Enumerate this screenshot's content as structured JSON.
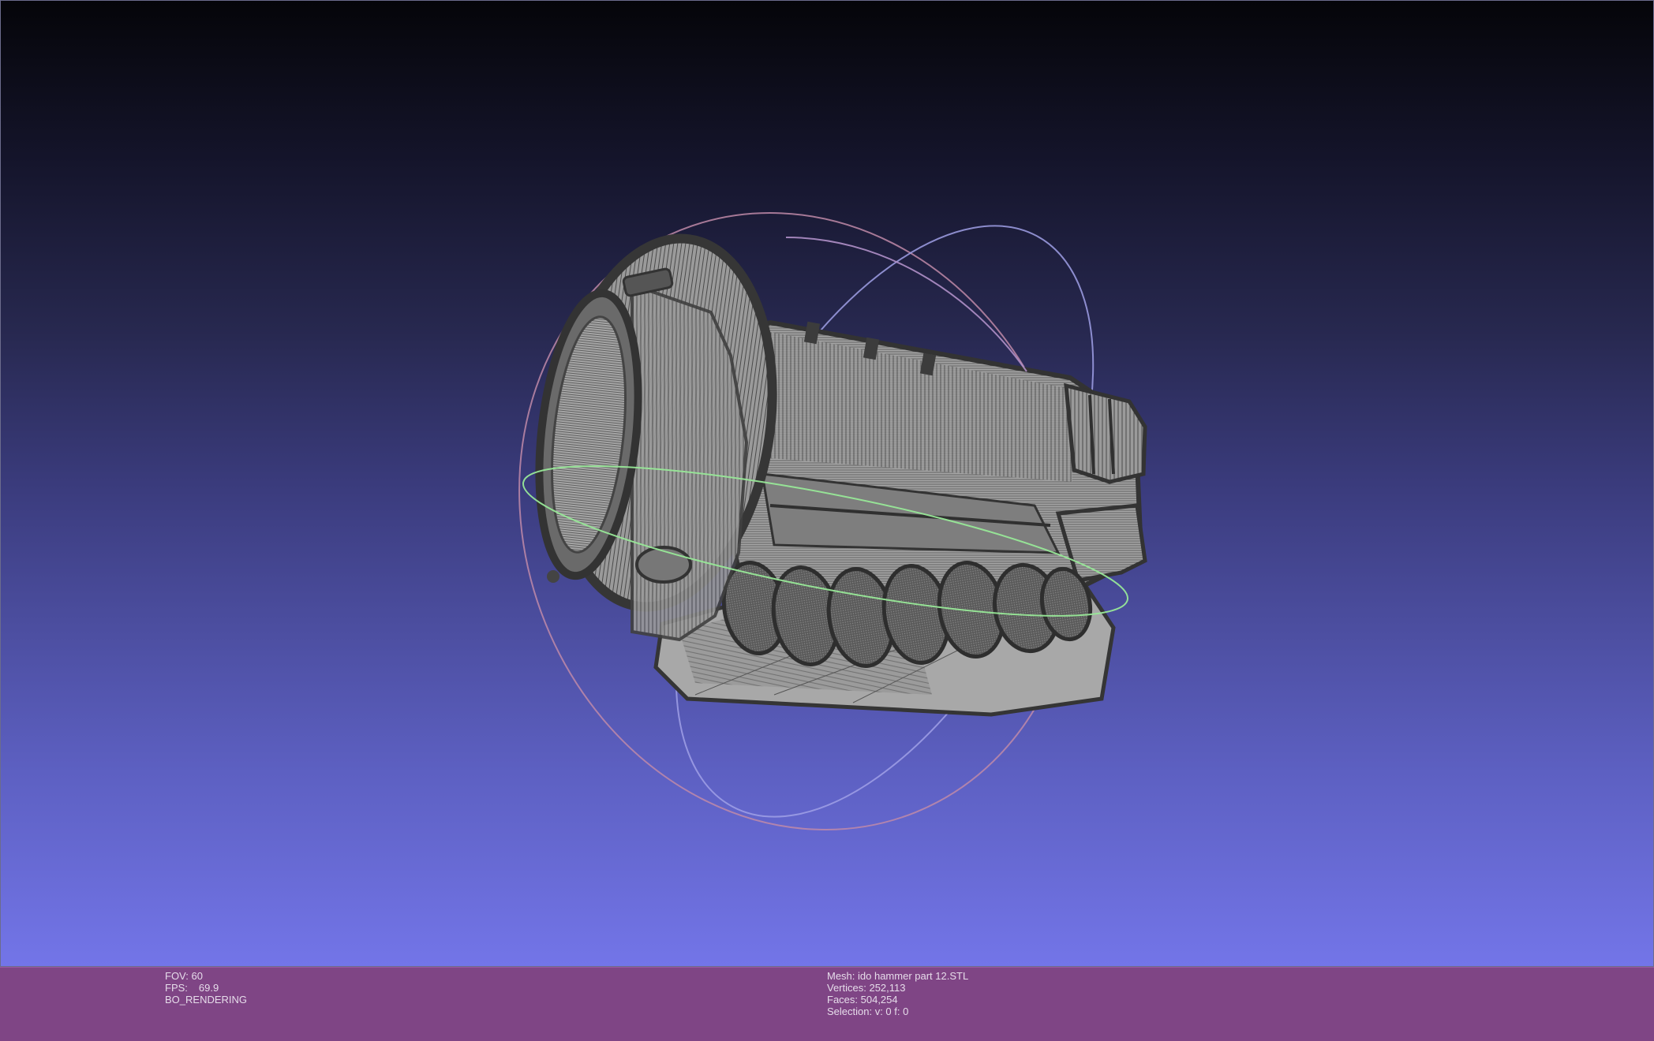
{
  "viewer": {
    "left_info": {
      "fov": "FOV: 60",
      "fps_label": "FPS:",
      "fps_value": "69.9",
      "render_mode": "BO_RENDERING"
    },
    "right_info": {
      "mesh": "Mesh: ido hammer part 12.STL",
      "vertices": "Vertices: 252,113",
      "faces": "Faces: 504,254",
      "selection": "Selection: v: 0 f: 0"
    }
  },
  "colors": {
    "background_top": "#050509",
    "background_bottom": "#7375e8",
    "status_bar": "#7f4585",
    "status_text": "#e6dcea",
    "mesh_fill": "#a6a6a6",
    "mesh_edges": "#3a3a3a",
    "trackball_x": "#e09090",
    "trackball_y": "#98e898",
    "trackball_z": "#a8a8f0"
  },
  "scene": {
    "object": "mesh-wireframe",
    "gizmo": "trackball-icon"
  }
}
